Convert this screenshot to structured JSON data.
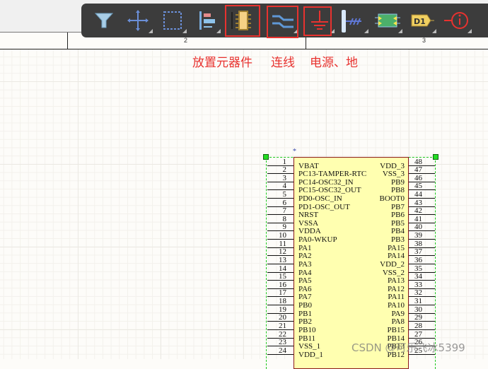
{
  "ruler": {
    "labels": [
      "2",
      "3"
    ]
  },
  "toolbar": {
    "items": [
      {
        "name": "filter-icon",
        "dropdown": false
      },
      {
        "name": "move-icon",
        "dropdown": true
      },
      {
        "name": "select-rect-icon",
        "dropdown": true
      },
      {
        "name": "align-icon",
        "dropdown": true
      },
      {
        "name": "place-part-icon",
        "dropdown": false,
        "highlighted": true
      },
      {
        "name": "wire-icon",
        "dropdown": true,
        "highlighted": true
      },
      {
        "name": "power-ground-icon",
        "dropdown": true,
        "highlighted": true
      },
      {
        "name": "bus-entry-icon",
        "dropdown": true
      },
      {
        "name": "harness-icon",
        "dropdown": true
      },
      {
        "name": "designator-icon",
        "dropdown": true,
        "label": "D1"
      },
      {
        "name": "directive-icon",
        "dropdown": true
      }
    ]
  },
  "annotations": {
    "place_part": "放置元器件",
    "wire": "连线",
    "power_ground": "电源、地"
  },
  "component": {
    "marker": "*",
    "left_pins": [
      [
        "1",
        "VBAT"
      ],
      [
        "2",
        "PC13-TAMPER-RTC"
      ],
      [
        "3",
        "PC14-OSC32_IN"
      ],
      [
        "4",
        "PC15-OSC32_OUT"
      ],
      [
        "5",
        "PD0-OSC_IN"
      ],
      [
        "6",
        "PD1-OSC_OUT"
      ],
      [
        "7",
        "NRST"
      ],
      [
        "8",
        "VSSA"
      ],
      [
        "9",
        "VDDA"
      ],
      [
        "10",
        "PA0-WKUP"
      ],
      [
        "11",
        "PA1"
      ],
      [
        "12",
        "PA2"
      ],
      [
        "13",
        "PA3"
      ],
      [
        "14",
        "PA4"
      ],
      [
        "15",
        "PA5"
      ],
      [
        "16",
        "PA6"
      ],
      [
        "17",
        "PA7"
      ],
      [
        "18",
        "PB0"
      ],
      [
        "19",
        "PB1"
      ],
      [
        "20",
        "PB2"
      ],
      [
        "21",
        "PB10"
      ],
      [
        "22",
        "PB11"
      ],
      [
        "23",
        "VSS_1"
      ],
      [
        "24",
        "VDD_1"
      ]
    ],
    "right_pins": [
      [
        "48",
        "VDD_3"
      ],
      [
        "47",
        "VSS_3"
      ],
      [
        "46",
        "PB9"
      ],
      [
        "45",
        "PB8"
      ],
      [
        "44",
        "BOOT0"
      ],
      [
        "43",
        "PB7"
      ],
      [
        "42",
        "PB6"
      ],
      [
        "41",
        "PB5"
      ],
      [
        "40",
        "PB4"
      ],
      [
        "39",
        "PB3"
      ],
      [
        "38",
        "PA15"
      ],
      [
        "37",
        "PA14"
      ],
      [
        "36",
        "VDD_2"
      ],
      [
        "35",
        "VSS_2"
      ],
      [
        "34",
        "PA13"
      ],
      [
        "33",
        "PA12"
      ],
      [
        "32",
        "PA11"
      ],
      [
        "31",
        "PA10"
      ],
      [
        "30",
        "PA9"
      ],
      [
        "29",
        "PA8"
      ],
      [
        "28",
        "PB15"
      ],
      [
        "27",
        "PB14"
      ],
      [
        "26",
        "PB13"
      ],
      [
        "25",
        "PB12"
      ]
    ]
  },
  "colors": {
    "annotation": "#e8322f",
    "body": "#ffffb0",
    "selection": "#1ec81e",
    "toolbar": "#3c3c3c"
  },
  "watermark": "CSDN @可乐飞冰5399"
}
